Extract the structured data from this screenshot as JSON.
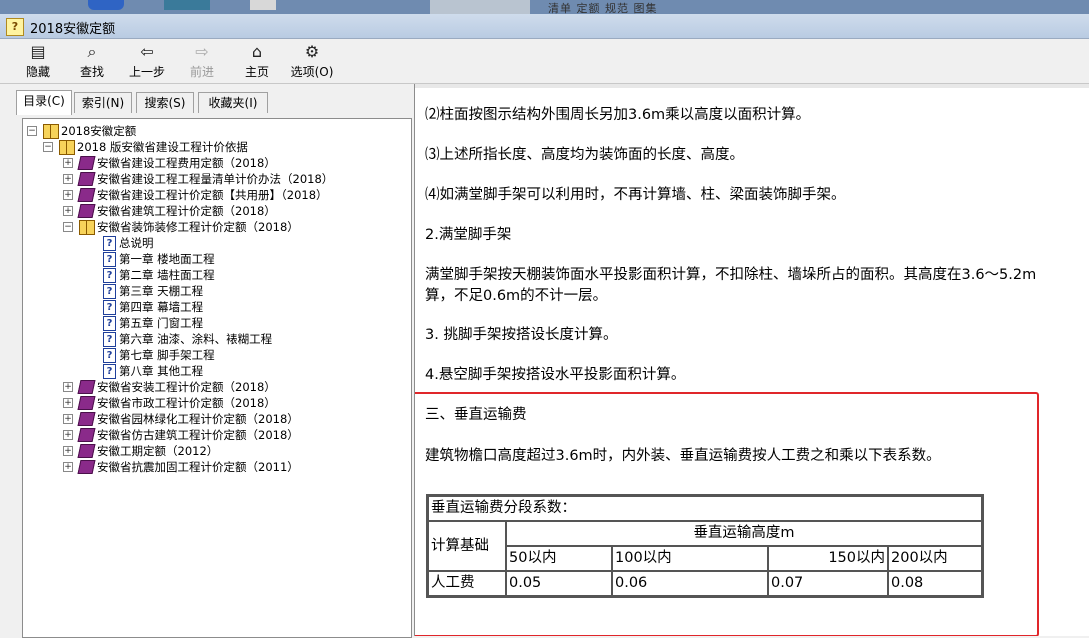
{
  "window": {
    "title": "2018安徽定额",
    "icon": "help-book-icon"
  },
  "background_strip": {
    "menu_text": "清单   定额   规范   图集"
  },
  "toolbar": {
    "hide_label": "隐藏",
    "find_label": "查找",
    "back_label": "上一步",
    "forward_label": "前进",
    "home_label": "主页",
    "options_label": "选项(O)"
  },
  "tabs": [
    {
      "label": "目录(C)",
      "active": true
    },
    {
      "label": "索引(N)",
      "active": false
    },
    {
      "label": "搜索(S)",
      "active": false
    },
    {
      "label": "收藏夹(I)",
      "active": false
    }
  ],
  "tree": {
    "root": "2018安徽定额",
    "basis": "2018 版安徽省建设工程计价依据",
    "items": [
      "安徽省建设工程费用定额（2018）",
      "安徽省建设工程工程量清单计价办法（2018）",
      "安徽省建设工程计价定额【共用册】（2018）",
      "安徽省建筑工程计价定额（2018）",
      "安徽省装饰装修工程计价定额（2018）"
    ],
    "chapters": [
      "总说明",
      "第一章  楼地面工程",
      "第二章  墙柱面工程",
      "第三章  天棚工程",
      "第四章  幕墙工程",
      "第五章  门窗工程",
      "第六章  油漆、涂料、裱糊工程",
      "第七章  脚手架工程",
      "第八章  其他工程"
    ],
    "more_items": [
      "安徽省安装工程计价定额（2018）",
      "安徽省市政工程计价定额（2018）",
      "安徽省园林绿化工程计价定额（2018）",
      "安徽省仿古建筑工程计价定额（2018）",
      "安徽工期定额（2012）",
      "安徽省抗震加固工程计价定额（2011）"
    ]
  },
  "content": {
    "p1": "⑵柱面按图示结构外围周长另加3.6m乘以高度以面积计算。",
    "p2": "⑶上述所指长度、高度均为装饰面的长度、高度。",
    "p3": "⑷如满堂脚手架可以利用时，不再计算墙、柱、梁面装饰脚手架。",
    "p4": "2.满堂脚手架",
    "p5a": "满堂脚手架按天棚装饰面水平投影面积计算，不扣除柱、墙垛所占的面积。其高度在3.6～5.2m",
    "p5b": "算，不足0.6m的不计一层。",
    "p6": "3. 挑脚手架按搭设长度计算。",
    "p7": "4.悬空脚手架按搭设水平投影面积计算。",
    "p8": "三、垂直运输费",
    "p9": "建筑物檐口高度超过3.6m时，内外装、垂直运输费按人工费之和乘以下表系数。",
    "table": {
      "caption": "垂直运输费分段系数：",
      "base_label": "计算基础",
      "height_header": "垂直运输高度m",
      "columns": [
        "50以内",
        "100以内",
        "150以内",
        "200以内"
      ],
      "row_label": "人工费",
      "values": [
        "0.05",
        "0.06",
        "0.07",
        "0.08"
      ]
    },
    "highlight_color": "#e0262a"
  }
}
